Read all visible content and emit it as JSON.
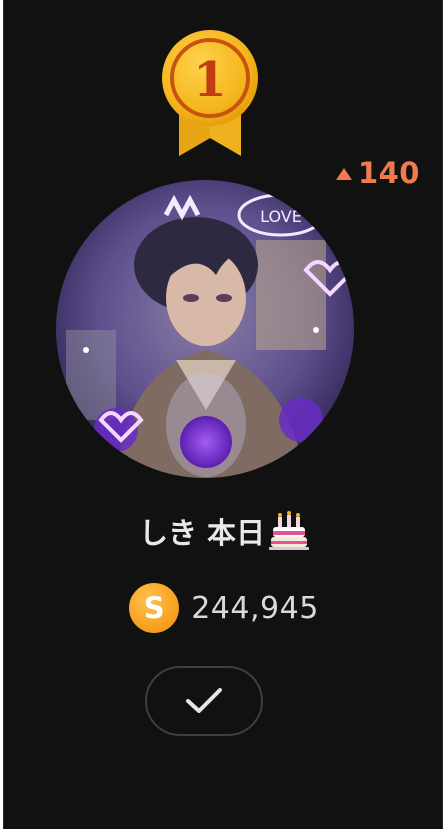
{
  "ranking": {
    "rank": "1",
    "rank_change": "140",
    "user_name": "しき 本日",
    "points": "244,945",
    "coin_letter": "S",
    "follow_state_icon": "check-icon"
  },
  "colors": {
    "card_background": "#121112",
    "medal_gold": "#f5b51c",
    "rank_up": "#f07a4e",
    "coin": "#f7a321",
    "text": "#e9e9e9"
  },
  "icons": {
    "medal": "gold-medal-icon",
    "rank_up": "triangle-up-icon",
    "cake": "birthday-cake-icon",
    "coin": "coin-icon"
  }
}
